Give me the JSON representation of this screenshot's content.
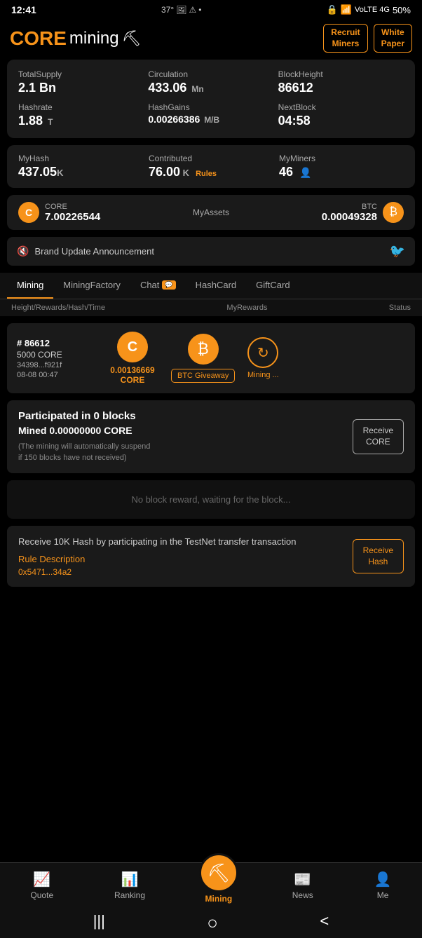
{
  "statusBar": {
    "time": "12:41",
    "temp": "37°",
    "battery": "50%"
  },
  "header": {
    "logoCore": "CORE",
    "logoMining": "mining",
    "logoEmoji": "⛏",
    "recruitBtn": "Recruit\nMiners",
    "whitepaperBtn": "White\nPaper"
  },
  "stats": {
    "totalSupplyLabel": "TotalSupply",
    "totalSupplyValue": "2.1 Bn",
    "circulationLabel": "Circulation",
    "circulationValue": "433.06",
    "circulationUnit": "Mn",
    "blockHeightLabel": "BlockHeight",
    "blockHeightValue": "86612",
    "hashrateLabel": "Hashrate",
    "hashrateValue": "1.88",
    "hashrateUnit": "T",
    "hashGainsLabel": "HashGains",
    "hashGainsValue": "0.00266386",
    "hashGainsUnit": "M/B",
    "nextBlockLabel": "NextBlock",
    "nextBlockValue": "04:58"
  },
  "myStats": {
    "myHashLabel": "MyHash",
    "myHashValue": "437.05",
    "myHashUnit": "K",
    "contributedLabel": "Contributed",
    "contributedValue": "76.00",
    "contributedUnit": "K",
    "rulesLink": "Rules",
    "myMinersLabel": "MyMiners",
    "myMinersValue": "46"
  },
  "assets": {
    "coreLabel": "CORE",
    "coreValue": "7.00226544",
    "myAssetsLabel": "MyAssets",
    "btcLabel": "BTC",
    "btcValue": "0.00049328"
  },
  "announcement": {
    "text": "Brand Update Announcement"
  },
  "tabs": [
    {
      "label": "Mining",
      "active": true
    },
    {
      "label": "MiningFactory",
      "active": false
    },
    {
      "label": "Chat",
      "badge": "💬",
      "active": false
    },
    {
      "label": "HashCard",
      "active": false
    },
    {
      "label": "GiftCard",
      "active": false
    }
  ],
  "tableHeader": {
    "col1": "Height/Rewards/Hash/Time",
    "col2": "MyRewards",
    "col3": "Status"
  },
  "miningRow": {
    "blockNum": "# 86612",
    "reward": "5000 CORE",
    "hash": "34398...f921f",
    "time": "08-08 00:47",
    "coreAmount": "0.00136669",
    "coreUnit": "CORE",
    "btcGiveaway": "BTC Giveaway",
    "statusText": "Mining ..."
  },
  "participated": {
    "title": "Participated in 0 blocks",
    "mined": "Mined 0.00000000 CORE",
    "note": "(The mining will automatically suspend\nif 150 blocks have not received)",
    "btnLabel": "Receive\nCORE"
  },
  "noReward": {
    "text": "No block reward, waiting for the block..."
  },
  "testnet": {
    "title": "Receive 10K Hash by participating in the TestNet transfer transaction",
    "ruleLink": "Rule Description",
    "address": "0x5471...34a2",
    "btnLabel": "Receive\nHash"
  },
  "bottomNav": [
    {
      "label": "Quote",
      "icon": "📈",
      "active": false
    },
    {
      "label": "Ranking",
      "icon": "📊",
      "active": false
    },
    {
      "label": "Mining",
      "icon": "⛏",
      "active": true,
      "center": true
    },
    {
      "label": "News",
      "icon": "📰",
      "active": false
    },
    {
      "label": "Me",
      "icon": "👤",
      "active": false
    }
  ],
  "androidNav": {
    "back": "|||",
    "home": "○",
    "recent": "<"
  }
}
